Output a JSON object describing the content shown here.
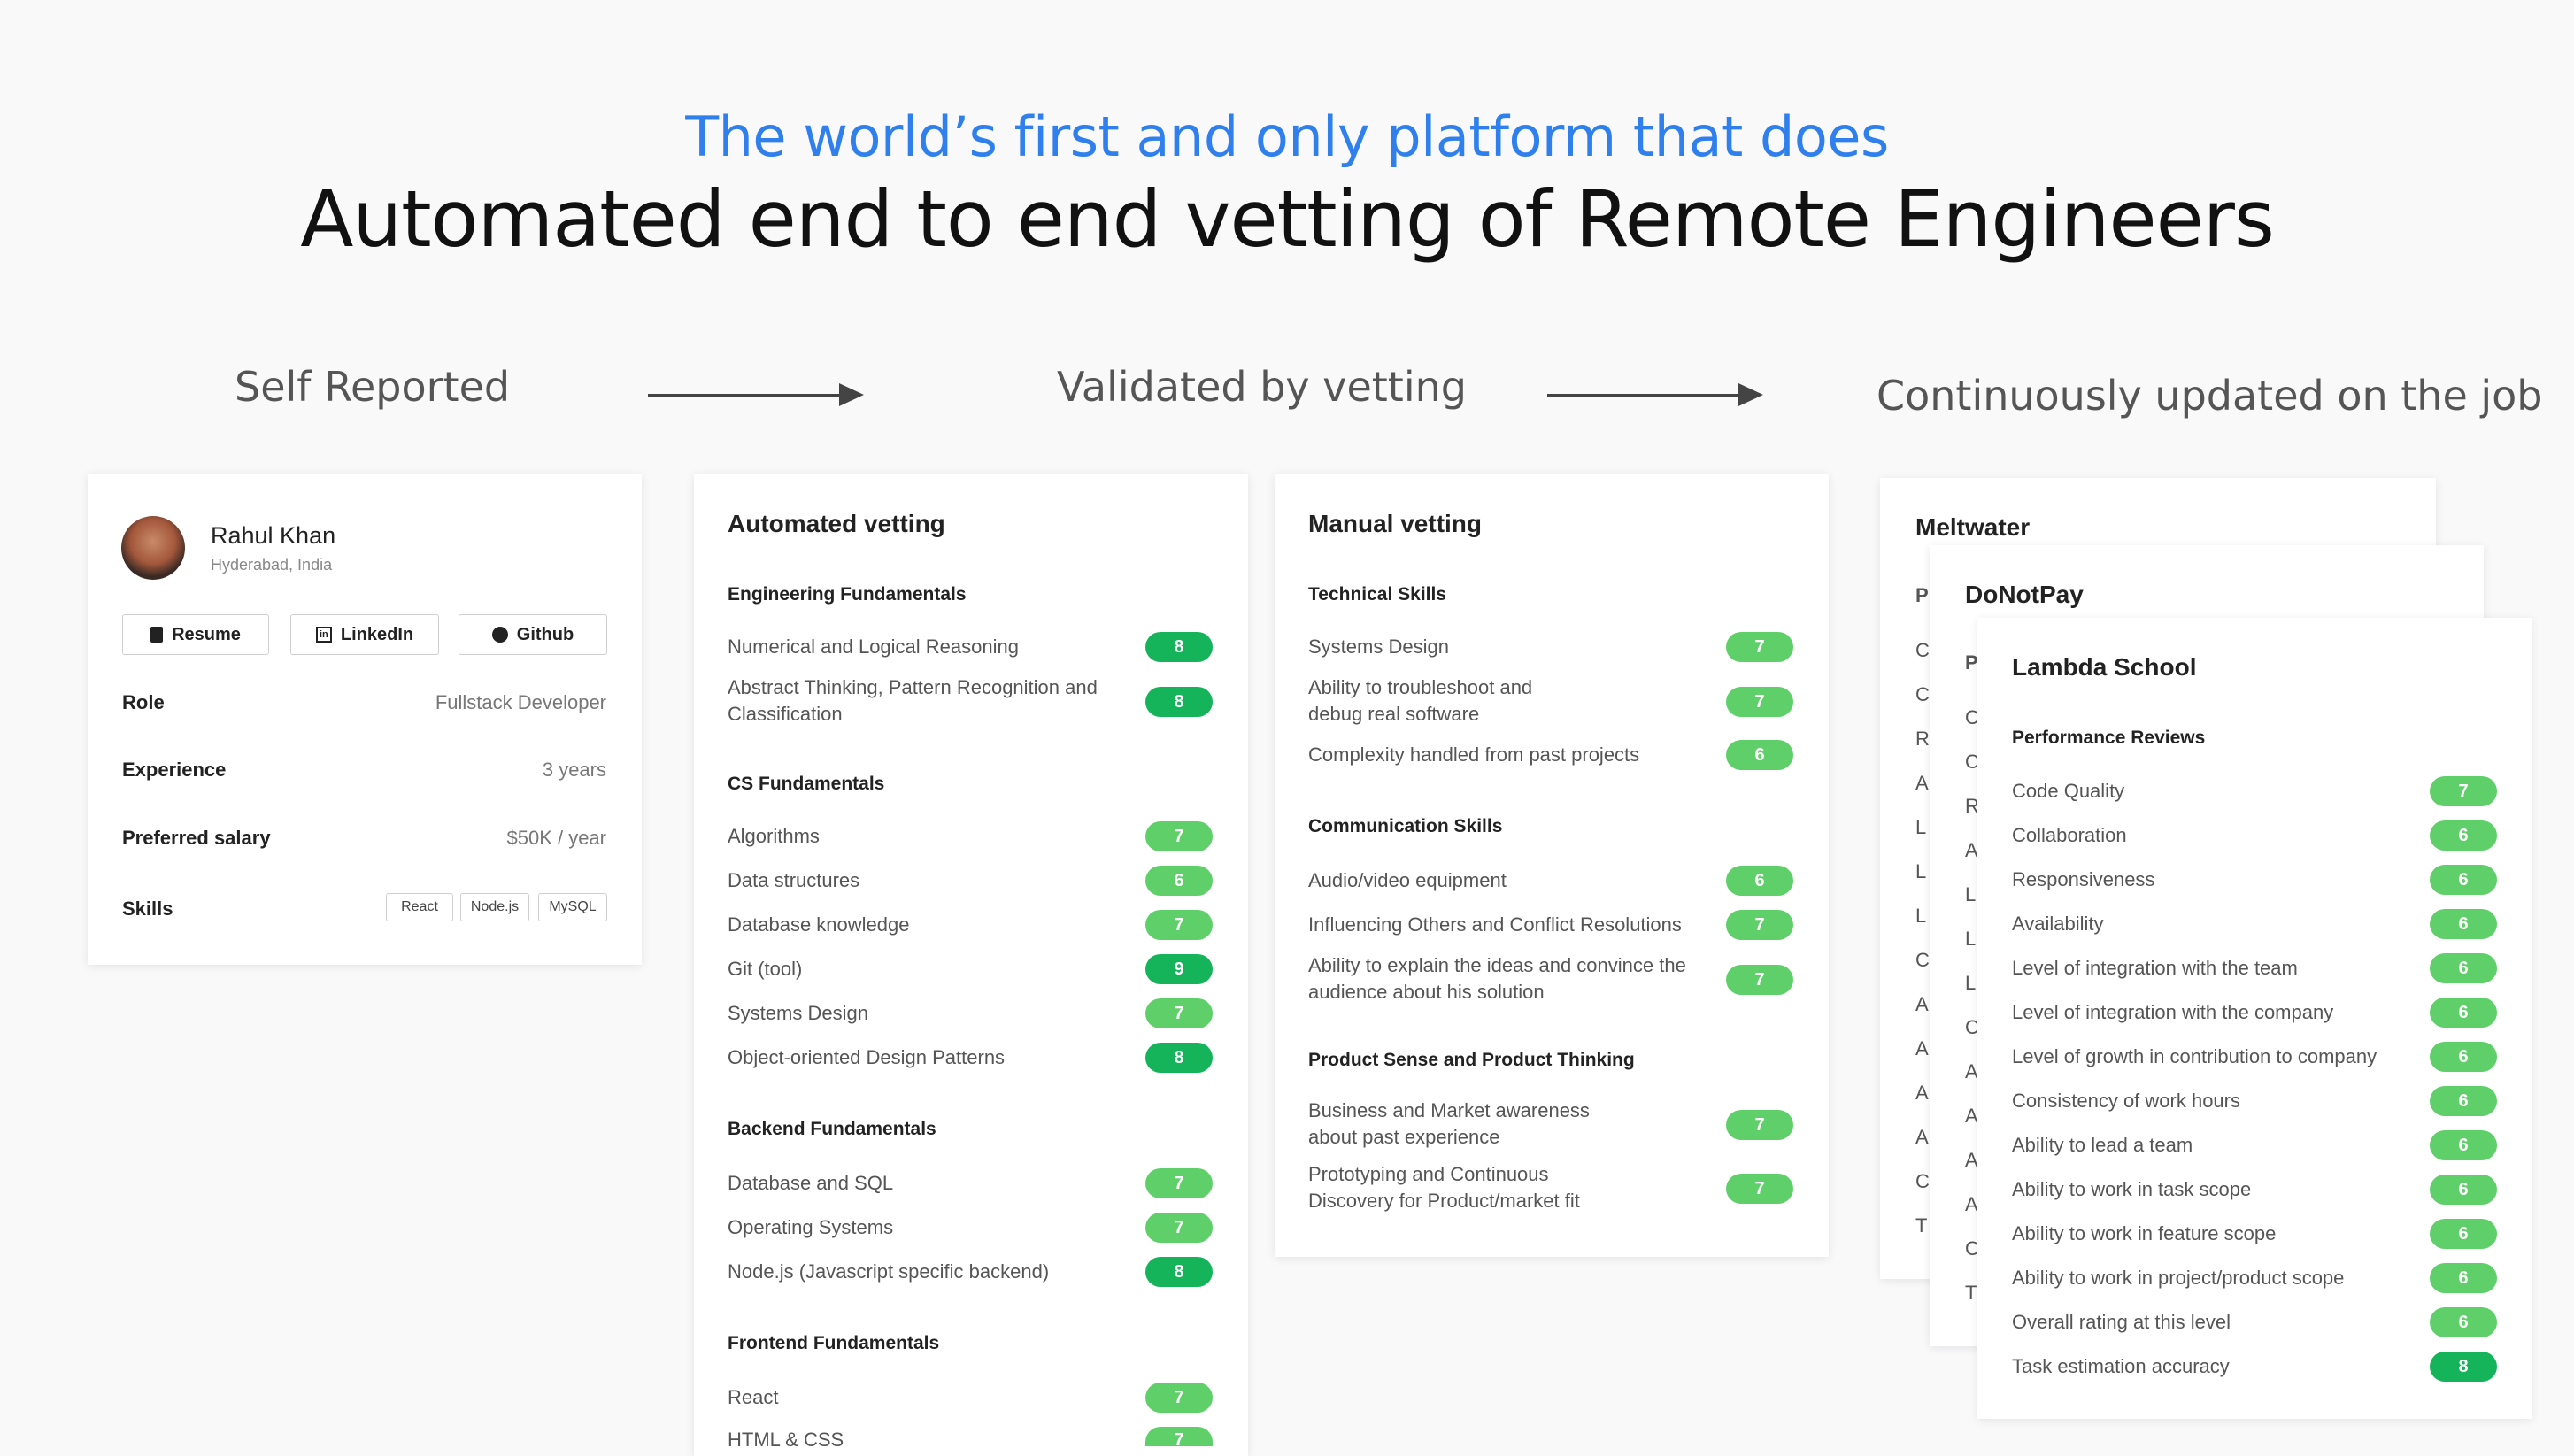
{
  "header": {
    "subtitle": "The world’s first and only platform that does",
    "headline": "Automated end to end vetting of Remote Engineers"
  },
  "stages": [
    "Self Reported",
    "Validated by vetting",
    "Continuously updated on the job"
  ],
  "profile": {
    "name": "Rahul Khan",
    "location": "Hyderabad, India",
    "buttons": [
      "Resume",
      "LinkedIn",
      "Github"
    ],
    "fields": [
      {
        "key": "Role",
        "value": "Fullstack Developer"
      },
      {
        "key": "Experience",
        "value": "3 years"
      },
      {
        "key": "Preferred salary",
        "value": "$50K / year"
      },
      {
        "key": "Skills",
        "value": ""
      }
    ],
    "skills": [
      "React",
      "Node.js",
      "MySQL"
    ]
  },
  "automated": {
    "title": "Automated vetting",
    "sections": [
      {
        "name": "Engineering Fundamentals",
        "items": [
          {
            "label": "Numerical and Logical Reasoning",
            "score": "8"
          },
          {
            "label": "Abstract Thinking, Pattern Recognition and Classification",
            "score": "8"
          }
        ]
      },
      {
        "name": "CS Fundamentals",
        "items": [
          {
            "label": "Algorithms",
            "score": "7"
          },
          {
            "label": "Data structures",
            "score": "6"
          },
          {
            "label": "Database knowledge",
            "score": "7"
          },
          {
            "label": "Git (tool)",
            "score": "9"
          },
          {
            "label": "Systems Design",
            "score": "7"
          },
          {
            "label": "Object-oriented Design Patterns",
            "score": "8"
          }
        ]
      },
      {
        "name": "Backend Fundamentals",
        "items": [
          {
            "label": "Database and SQL",
            "score": "7"
          },
          {
            "label": "Operating Systems",
            "score": "7"
          },
          {
            "label": "Node.js (Javascript specific backend)",
            "score": "8"
          }
        ]
      },
      {
        "name": "Frontend Fundamentals",
        "items": [
          {
            "label": "React",
            "score": "7"
          },
          {
            "label": "HTML & CSS",
            "score": "7"
          }
        ]
      }
    ]
  },
  "manual": {
    "title": "Manual vetting",
    "sections": [
      {
        "name": "Technical Skills",
        "items": [
          {
            "label": "Systems Design",
            "score": "7"
          },
          {
            "label": "Ability to troubleshoot and debug real software",
            "score": "7"
          },
          {
            "label": "Complexity handled from past projects",
            "score": "6"
          }
        ]
      },
      {
        "name": "Communication Skills",
        "items": [
          {
            "label": "Audio/video equipment",
            "score": "6"
          },
          {
            "label": "Influencing Others and Conflict Resolutions",
            "score": "7"
          },
          {
            "label": "Ability to explain the ideas and convince the audience about his solution",
            "score": "7"
          }
        ]
      },
      {
        "name": "Product Sense and Product Thinking",
        "items": [
          {
            "label": "Business and Market awareness about past experience",
            "score": "7"
          },
          {
            "label": "Prototyping and Continuous Discovery for Product/market fit",
            "score": "7"
          }
        ]
      }
    ]
  },
  "jobs": {
    "back_card_title": "Meltwater",
    "middle_card_title": "DoNotPay",
    "front": {
      "title": "Lambda School",
      "section": "Performance Reviews",
      "items": [
        {
          "label": "Code Quality",
          "score": "7"
        },
        {
          "label": "Collaboration",
          "score": "6"
        },
        {
          "label": "Responsiveness",
          "score": "6"
        },
        {
          "label": "Availability",
          "score": "6"
        },
        {
          "label": "Level of integration with the team",
          "score": "6"
        },
        {
          "label": "Level of integration with the company",
          "score": "6"
        },
        {
          "label": "Level of growth in contribution to company",
          "score": "6"
        },
        {
          "label": "Consistency of work hours",
          "score": "6"
        },
        {
          "label": "Ability to lead a team",
          "score": "6"
        },
        {
          "label": "Ability to work in task scope",
          "score": "6"
        },
        {
          "label": "Ability to work in feature scope",
          "score": "6"
        },
        {
          "label": "Ability to work in project/product scope",
          "score": "6"
        },
        {
          "label": "Overall rating at this level",
          "score": "6"
        },
        {
          "label": "Task estimation accuracy",
          "score": "8"
        }
      ]
    },
    "back_letters": [
      "P",
      "C",
      "C",
      "R",
      "A",
      "L",
      "L",
      "L",
      "C",
      "A",
      "A",
      "A",
      "A",
      "C",
      "T"
    ],
    "middle_letters": [
      "P",
      "C",
      "C",
      "R",
      "A",
      "L",
      "L",
      "L",
      "C",
      "A",
      "A",
      "A",
      "A",
      "C",
      "T"
    ]
  },
  "colors": {
    "accent": "#2f80ed",
    "pill": "#5fd069",
    "pill_high": "#16b45a"
  }
}
